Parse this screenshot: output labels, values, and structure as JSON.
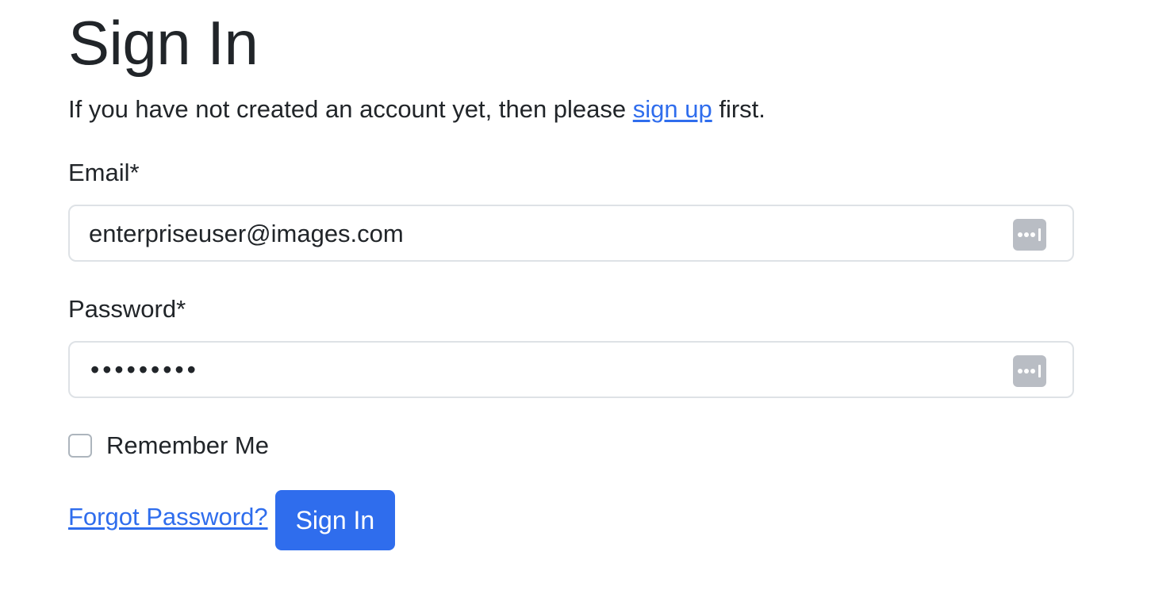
{
  "page": {
    "title": "Sign In",
    "intro_before": "If you have not created an account yet, then please ",
    "intro_link": "sign up",
    "intro_after": " first."
  },
  "form": {
    "email_label": "Email*",
    "email_value": "enterpriseuser@images.com",
    "password_label": "Password*",
    "password_masked": "•••••••••",
    "remember_label": "Remember Me",
    "remember_checked": false,
    "forgot_link": "Forgot Password?",
    "submit_label": "Sign In"
  },
  "icons": {
    "password_manager_key": "password-manager-key-icon"
  },
  "colors": {
    "accent": "#2f6ded",
    "text": "#212529",
    "border": "#dee2e6",
    "key_icon_bg": "#b9bdc4"
  }
}
